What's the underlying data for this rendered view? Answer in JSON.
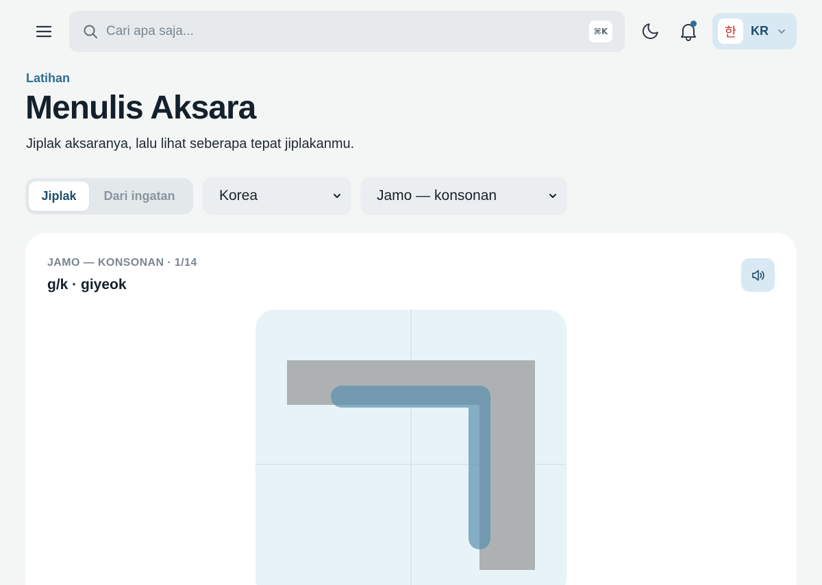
{
  "topbar": {
    "menu_icon": "hamburger-menu-icon",
    "search": {
      "placeholder": "Cari apa saja...",
      "shortcut": "⌘K",
      "icon": "search-icon"
    },
    "theme_icon": "moon-icon",
    "notifications": {
      "icon": "bell-icon",
      "has_unread": true
    },
    "language": {
      "flag_glyph": "한",
      "code": "KR",
      "icon": "chevron-down-icon"
    }
  },
  "header": {
    "eyebrow": "Latihan",
    "title": "Menulis Aksara",
    "subtitle": "Jiplak aksaranya, lalu lihat seberapa tepat jiplakanmu."
  },
  "controls": {
    "mode_tabs": [
      {
        "label": "Jiplak",
        "active": true
      },
      {
        "label": "Dari ingatan",
        "active": false
      }
    ],
    "script_select": {
      "value": "Korea"
    },
    "set_select": {
      "value": "Jamo — konsonan"
    }
  },
  "card": {
    "meta": "JAMO — KONSONAN · 1/14",
    "character": "g/k · giyeok",
    "sound_icon": "speaker-icon"
  },
  "colors": {
    "accent": "#2e6e94",
    "background": "#f4f6f6",
    "canvas": "#e7f3f7",
    "guide_glyph": "#adb1b3",
    "trace_stroke": "#5a8fb0"
  }
}
